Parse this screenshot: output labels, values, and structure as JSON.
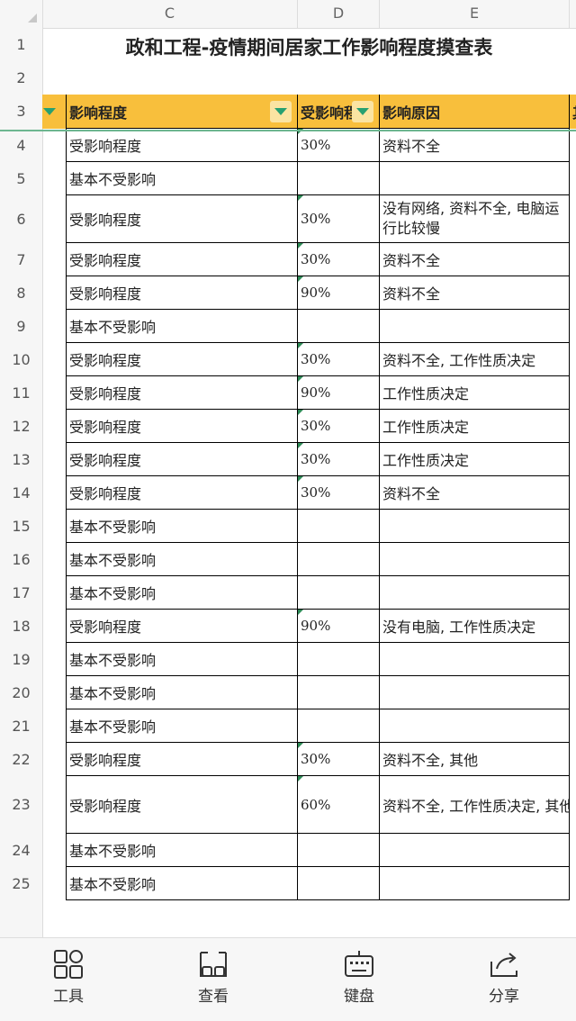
{
  "columns": [
    "C",
    "D",
    "E"
  ],
  "title": "政和工程-疫情期间居家工作影响程度摸查表",
  "header": {
    "c": "影响程度",
    "d": "受影响程",
    "e": "影响原因",
    "f": "其"
  },
  "rows": [
    {
      "num": "4",
      "c": "受影响程度",
      "d": "30%",
      "e": "资料不全"
    },
    {
      "num": "5",
      "c": "基本不受影响",
      "d": "",
      "e": ""
    },
    {
      "num": "6",
      "c": "受影响程度",
      "d": "30%",
      "e": "没有网络, 资料不全, 电脑运行比较慢"
    },
    {
      "num": "7",
      "c": "受影响程度",
      "d": "30%",
      "e": "资料不全"
    },
    {
      "num": "8",
      "c": "受影响程度",
      "d": "90%",
      "e": "资料不全"
    },
    {
      "num": "9",
      "c": "基本不受影响",
      "d": "",
      "e": ""
    },
    {
      "num": "10",
      "c": "受影响程度",
      "d": "30%",
      "e": "资料不全, 工作性质决定"
    },
    {
      "num": "11",
      "c": "受影响程度",
      "d": "90%",
      "e": "工作性质决定"
    },
    {
      "num": "12",
      "c": "受影响程度",
      "d": "30%",
      "e": "工作性质决定"
    },
    {
      "num": "13",
      "c": "受影响程度",
      "d": "30%",
      "e": "工作性质决定"
    },
    {
      "num": "14",
      "c": "受影响程度",
      "d": "30%",
      "e": "资料不全"
    },
    {
      "num": "15",
      "c": "基本不受影响",
      "d": "",
      "e": ""
    },
    {
      "num": "16",
      "c": "基本不受影响",
      "d": "",
      "e": ""
    },
    {
      "num": "17",
      "c": "基本不受影响",
      "d": "",
      "e": ""
    },
    {
      "num": "18",
      "c": "受影响程度",
      "d": "90%",
      "e": "没有电脑, 工作性质决定"
    },
    {
      "num": "19",
      "c": "基本不受影响",
      "d": "",
      "e": ""
    },
    {
      "num": "20",
      "c": "基本不受影响",
      "d": "",
      "e": ""
    },
    {
      "num": "21",
      "c": "基本不受影响",
      "d": "",
      "e": ""
    },
    {
      "num": "22",
      "c": "受影响程度",
      "d": "30%",
      "e": "资料不全, 其他"
    },
    {
      "num": "23",
      "c": "受影响程度",
      "d": "60%",
      "e": "资料不全, 工作性质决定, 其他"
    },
    {
      "num": "24",
      "c": "基本不受影响",
      "d": "",
      "e": ""
    },
    {
      "num": "25",
      "c": "基本不受影响",
      "d": "",
      "e": ""
    }
  ],
  "toolbar": [
    {
      "label": "工具",
      "icon": "tools-icon"
    },
    {
      "label": "查看",
      "icon": "view-icon"
    },
    {
      "label": "键盘",
      "icon": "keyboard-icon"
    },
    {
      "label": "分享",
      "icon": "share-icon"
    }
  ],
  "colors": {
    "header_fill": "#f8bf3c",
    "accent": "#27a071"
  }
}
